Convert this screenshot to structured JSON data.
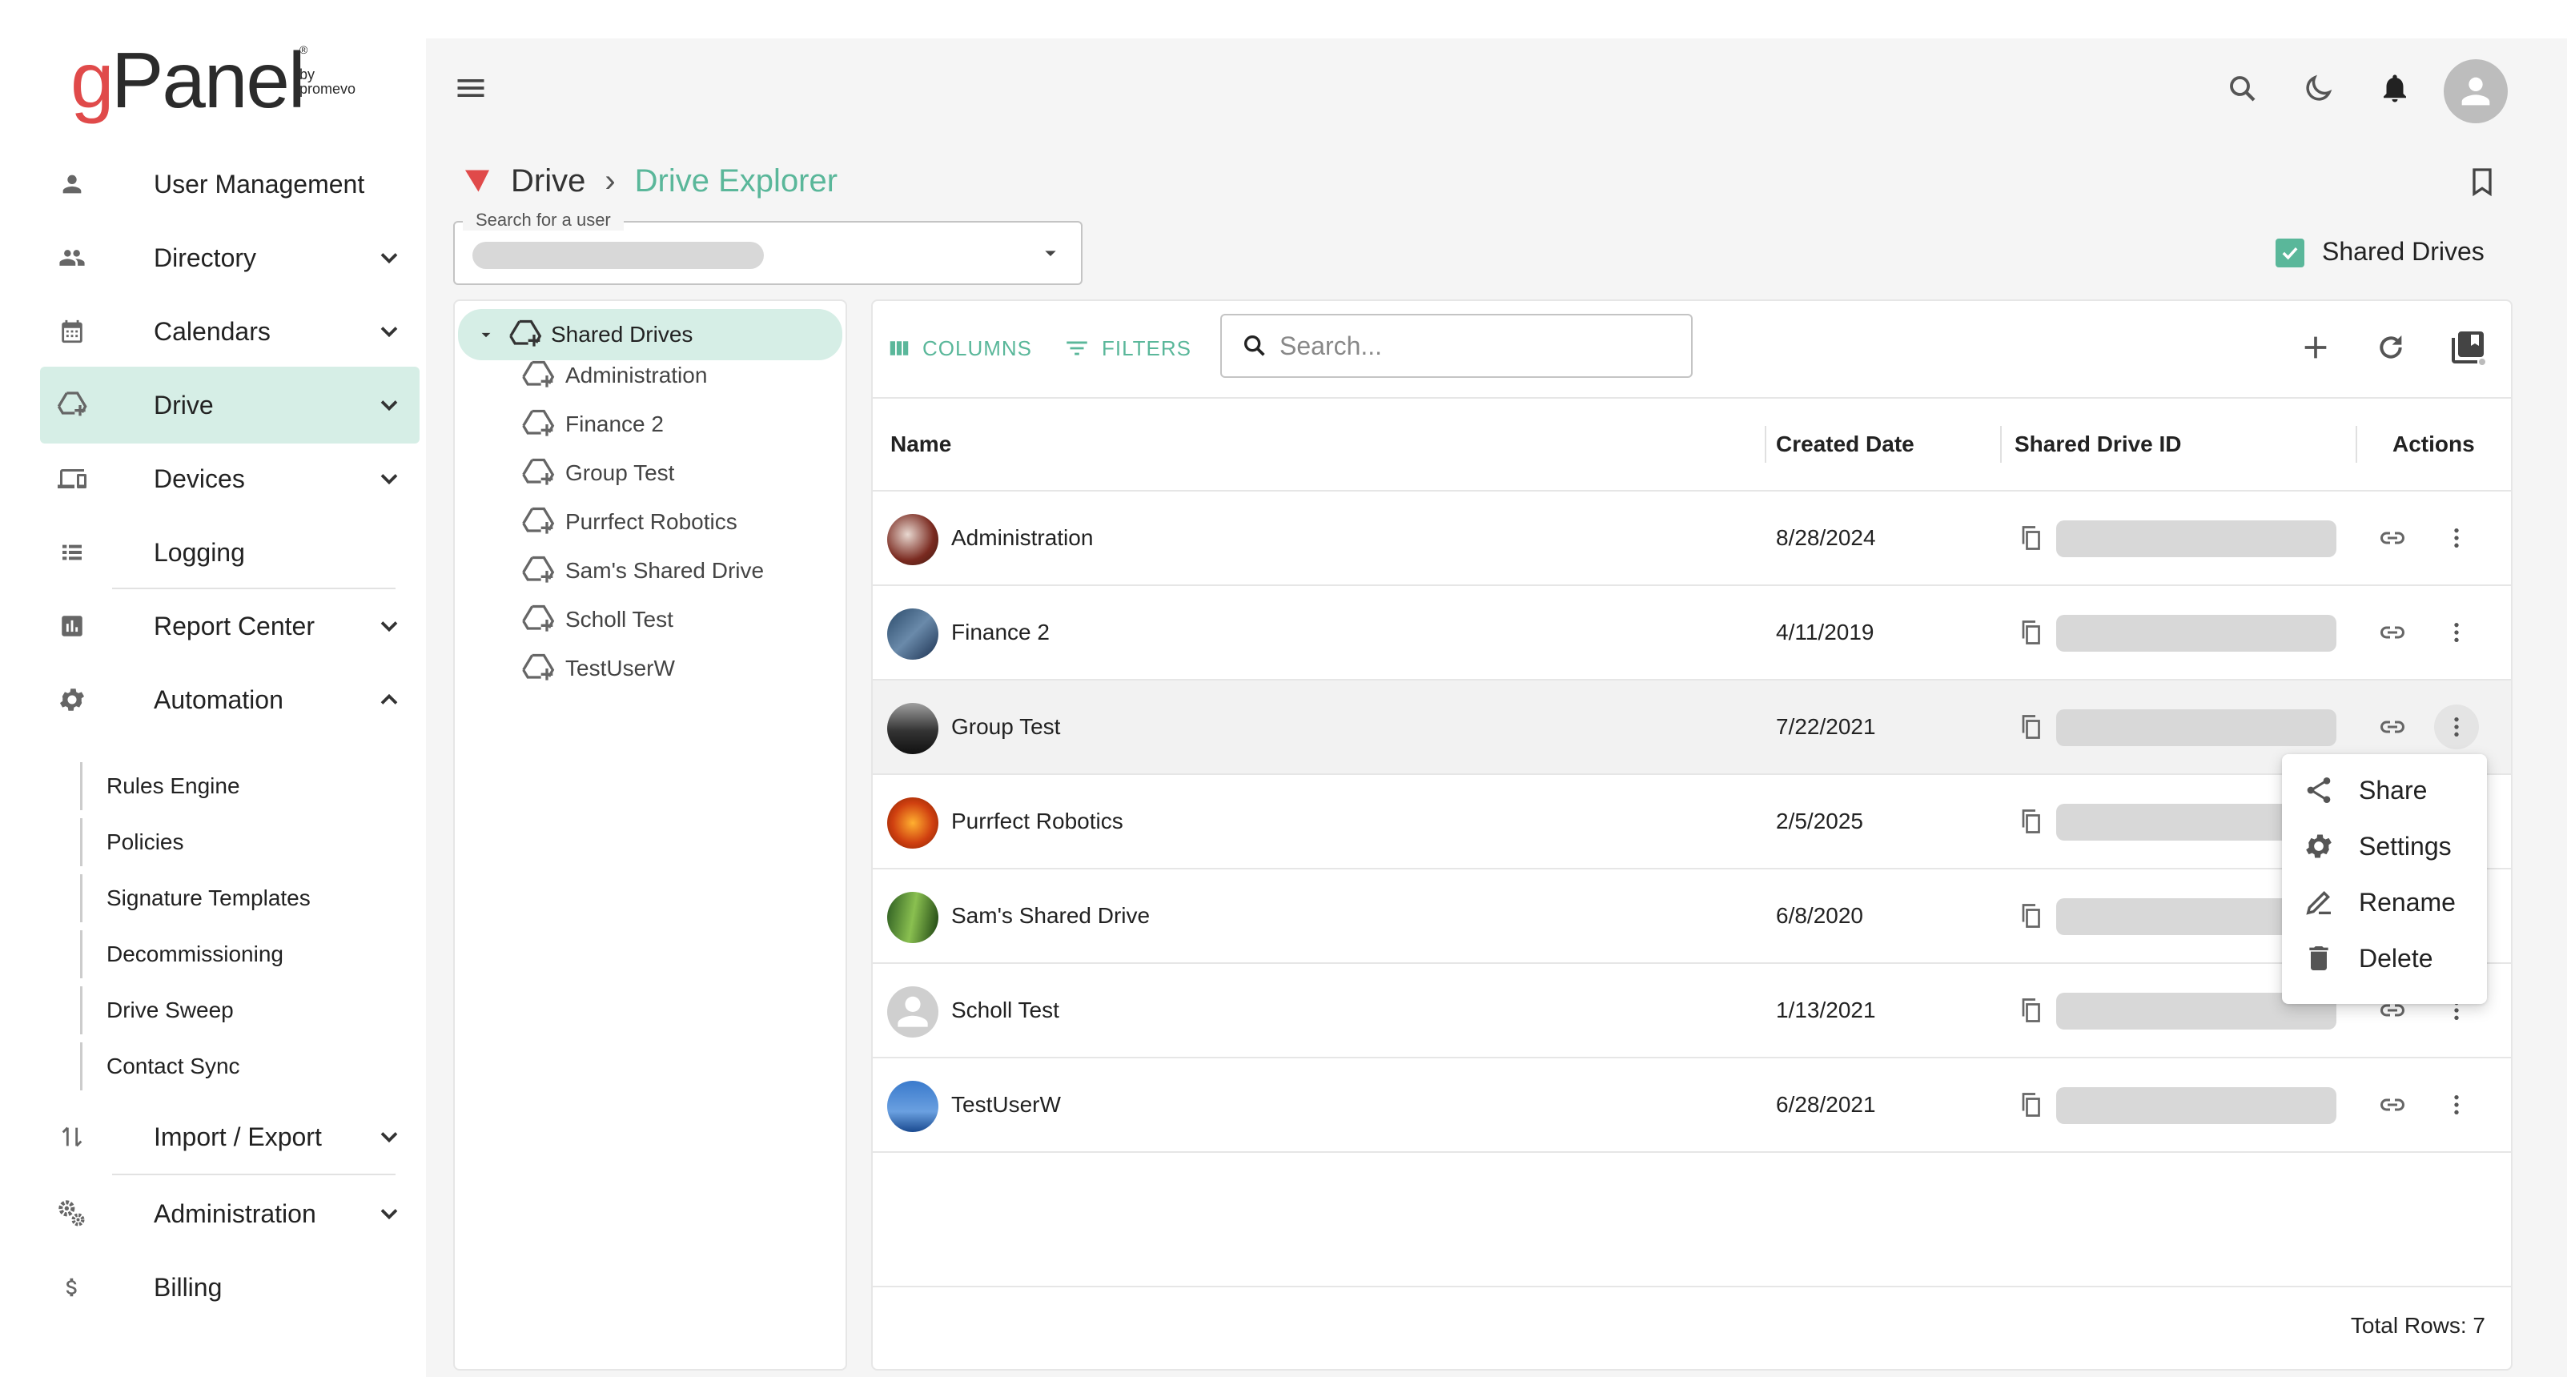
{
  "app": {
    "logo_g": "g",
    "logo_panel": "Panel",
    "logo_by": "by",
    "logo_promevo": "promevo",
    "logo_reg": "®"
  },
  "sidebar": {
    "items": [
      {
        "label": "User Management",
        "icon": "person-icon"
      },
      {
        "label": "Directory",
        "icon": "people-icon"
      },
      {
        "label": "Calendars",
        "icon": "calendar-icon"
      },
      {
        "label": "Drive",
        "icon": "drive-icon",
        "active": true
      },
      {
        "label": "Devices",
        "icon": "devices-icon"
      },
      {
        "label": "Logging",
        "icon": "list-icon"
      },
      {
        "label": "Report Center",
        "icon": "chart-icon"
      },
      {
        "label": "Automation",
        "icon": "gear-icon",
        "expanded": true
      },
      {
        "label": "Import / Export",
        "icon": "import-export-icon"
      },
      {
        "label": "Administration",
        "icon": "gears-icon"
      },
      {
        "label": "Billing",
        "icon": "dollar-icon"
      }
    ],
    "automation_sub": [
      "Rules Engine",
      "Policies",
      "Signature Templates",
      "Decommissioning",
      "Drive Sweep",
      "Contact Sync"
    ]
  },
  "breadcrumb": {
    "root": "Drive",
    "separator": "›",
    "current": "Drive Explorer"
  },
  "user_search": {
    "label": "Search for a user"
  },
  "shared_drives_toggle": {
    "label": "Shared Drives",
    "checked": true
  },
  "tree": {
    "root": "Shared Drives",
    "children": [
      "Administration",
      "Finance 2",
      "Group Test",
      "Purrfect Robotics",
      "Sam's Shared Drive",
      "Scholl Test",
      "TestUserW"
    ]
  },
  "toolbar": {
    "columns_label": "COLUMNS",
    "filters_label": "FILTERS",
    "search_placeholder": "Search..."
  },
  "table": {
    "columns": [
      "Name",
      "Created Date",
      "Shared Drive ID",
      "Actions"
    ],
    "rows": [
      {
        "name": "Administration",
        "created": "8/28/2024"
      },
      {
        "name": "Finance 2",
        "created": "4/11/2019"
      },
      {
        "name": "Group Test",
        "created": "7/22/2021"
      },
      {
        "name": "Purrfect Robotics",
        "created": "2/5/2025"
      },
      {
        "name": "Sam's Shared Drive",
        "created": "6/8/2020"
      },
      {
        "name": "Scholl Test",
        "created": "1/13/2021"
      },
      {
        "name": "TestUserW",
        "created": "6/28/2021"
      }
    ],
    "total_rows": "Total Rows: 7"
  },
  "context_menu": {
    "items": [
      {
        "label": "Share",
        "icon": "share-icon"
      },
      {
        "label": "Settings",
        "icon": "settings-icon"
      },
      {
        "label": "Rename",
        "icon": "rename-icon"
      },
      {
        "label": "Delete",
        "icon": "delete-icon"
      }
    ]
  },
  "colors": {
    "accent": "#5ab79a",
    "active_bg": "#d6eee6",
    "brand_red": "#e04a4a"
  }
}
